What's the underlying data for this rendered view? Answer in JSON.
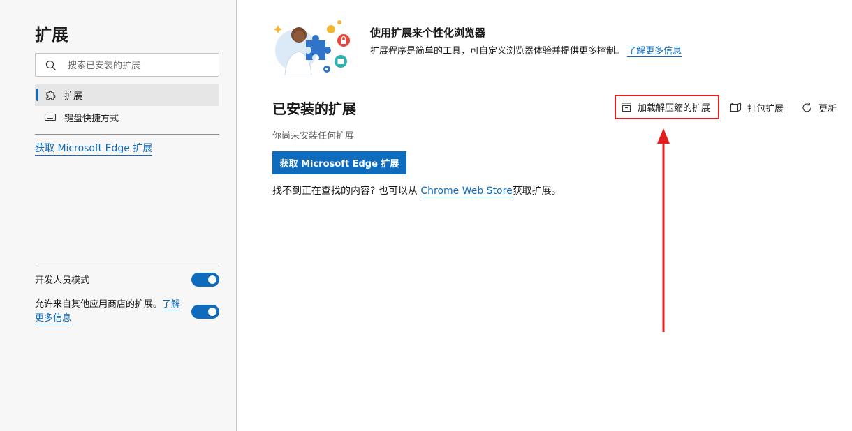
{
  "sidebar": {
    "title": "扩展",
    "search": {
      "placeholder": "搜索已安装的扩展",
      "icon": "search-icon"
    },
    "items": [
      {
        "label": "扩展",
        "icon": "puzzle-icon",
        "active": true
      },
      {
        "label": "键盘快捷方式",
        "icon": "keyboard-icon",
        "active": false
      }
    ],
    "get_link": "获取 Microsoft Edge 扩展",
    "developer_mode": {
      "label": "开发人员模式",
      "enabled": true
    },
    "allow_other_stores": {
      "label": "允许来自其他应用商店的扩展。",
      "link": "了解更多信息",
      "enabled": true
    }
  },
  "hero": {
    "title": "使用扩展来个性化浏览器",
    "description": "扩展程序是简单的工具，可自定义浏览器体验并提供更多控制。",
    "link": "了解更多信息"
  },
  "main": {
    "installed_title": "已安装的扩展",
    "toolbar": {
      "load_unpacked": "加载解压缩的扩展",
      "pack": "打包扩展",
      "update": "更新"
    },
    "empty_message": "你尚未安装任何扩展",
    "get_button": "获取 Microsoft Edge 扩展",
    "find_prefix": "找不到正在查找的内容? 也可以从",
    "find_link": "Chrome Web Store",
    "find_suffix": "获取扩展。"
  },
  "colors": {
    "accent": "#0f6cbd",
    "highlight": "#e02020"
  }
}
